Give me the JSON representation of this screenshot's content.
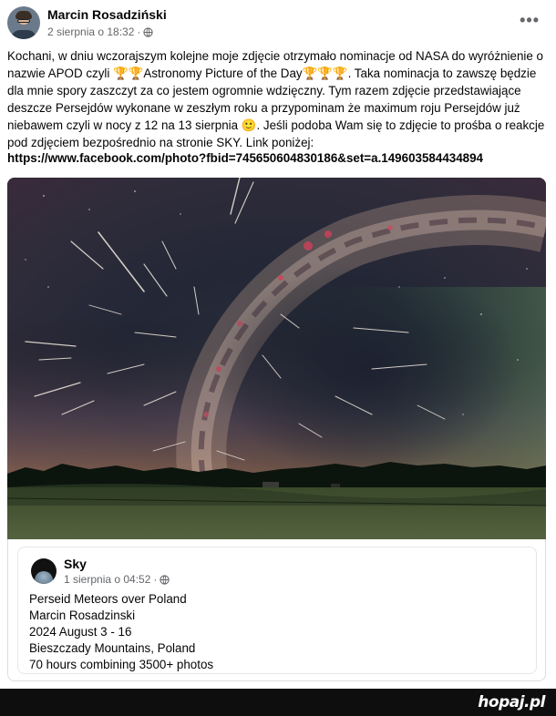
{
  "post": {
    "author": "Marcin Rosadziński",
    "date": "2 sierpnia o 18:32",
    "separator": "·",
    "menu_icon": "more-horizontal-icon",
    "text": "Kochani, w dniu wczorajszym kolejne moje zdjęcie otrzymało nominacje od NASA do wyróżnienie o nazwie APOD czyli 🏆🏆Astronomy Picture of the Day🏆🏆🏆. Taka nominacja to zawszę będzie dla mnie spory zaszczyt za co jestem ogromnie wdzięczny.  Tym razem zdjęcie przedstawiające deszcze Persejdów wykonane w zeszłym roku a przypominam że maximum roju Persejdów już niebawem czyli w nocy z 12 na 13 sierpnia 🙂.  Jeśli podoba Wam się to zdjęcie to prośba o reakcje pod zdjęciem bezpośrednio na stronie SKY. Link poniżej:",
    "link": "https://www.facebook.com/photo?fbid=745650604830186&set=a.149603584434894"
  },
  "shared": {
    "page_name": "Sky",
    "date": "1 sierpnia o 04:52",
    "separator": "·",
    "lines": [
      "Perseid Meteors over Poland",
      "Marcin Rosadzinski",
      "2024 August 3 - 16",
      "Bieszczady Mountains, Poland",
      "70 hours combining 3500+ photos"
    ]
  },
  "watermark": "hopaj.pl",
  "colors": {
    "text": "#050505",
    "meta": "#65676b",
    "border": "#dadde1",
    "footer": "#0e0e0e"
  }
}
